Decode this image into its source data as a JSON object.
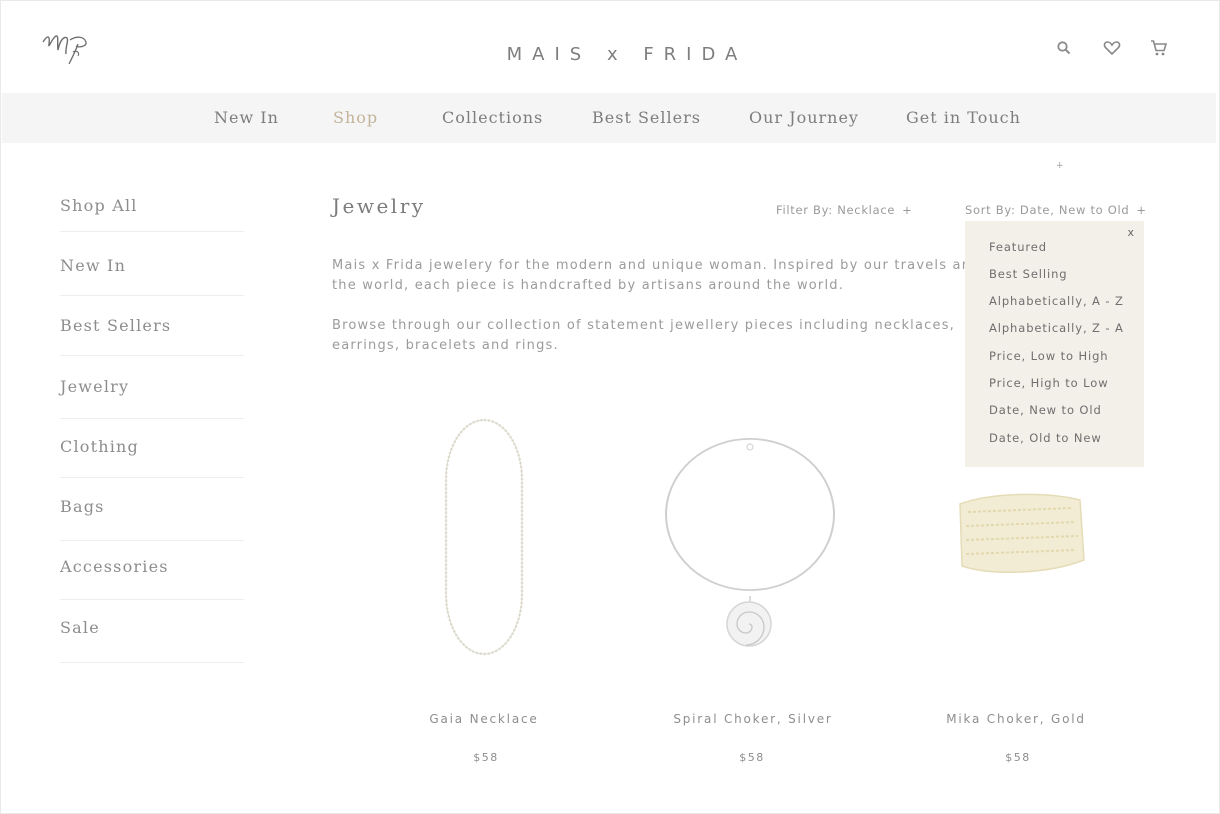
{
  "header": {
    "brand": "MAIS x FRIDA",
    "icons": [
      "logo-monogram",
      "search-icon",
      "heart-icon",
      "cart-icon"
    ]
  },
  "nav": {
    "items": [
      {
        "label": "New In"
      },
      {
        "label": "Shop",
        "active": true
      },
      {
        "label": "Collections"
      },
      {
        "label": "Best Sellers"
      },
      {
        "label": "Our Journey"
      },
      {
        "label": "Get in Touch"
      }
    ],
    "caret": "+"
  },
  "sidebar": {
    "items": [
      {
        "label": "Shop All"
      },
      {
        "label": "New In"
      },
      {
        "label": "Best Sellers"
      },
      {
        "label": "Jewelry"
      },
      {
        "label": "Clothing"
      },
      {
        "label": "Bags"
      },
      {
        "label": "Accessories"
      },
      {
        "label": "Sale"
      }
    ]
  },
  "main": {
    "title": "Jewelry",
    "filter": {
      "label": "Filter By: Necklace",
      "icon": "+"
    },
    "sort": {
      "label": "Sort By: Date, New to Old",
      "icon": "+"
    },
    "description": [
      "Mais x Frida jewelery for the modern and unique woman. Inspired by our travels around the world, each piece is handcrafted by artisans around the world.",
      "Browse through our collection of statement jewellery pieces including necklaces, earrings, bracelets and rings."
    ]
  },
  "sort_menu": {
    "close": "x",
    "options": [
      "Featured",
      "Best Selling",
      "Alphabetically, A - Z",
      "Alphabetically, Z - A",
      "Price, Low to High",
      "Price, High to Low",
      "Date, New to Old",
      "Date, Old to New"
    ]
  },
  "products": [
    {
      "name": "Gaia Necklace",
      "price": "$58",
      "image": "long-beaded-necklace"
    },
    {
      "name": "Spiral Choker, Silver",
      "price": "$58",
      "image": "silver-spiral-choker"
    },
    {
      "name": "Mika Choker, Gold",
      "price": "$58",
      "image": "gold-woven-choker"
    }
  ],
  "colors": {
    "nav_bg": "#f5f5f5",
    "accent": "#c3b49a",
    "menu_bg": "#f3efe9",
    "text": "#8a8a8a"
  }
}
